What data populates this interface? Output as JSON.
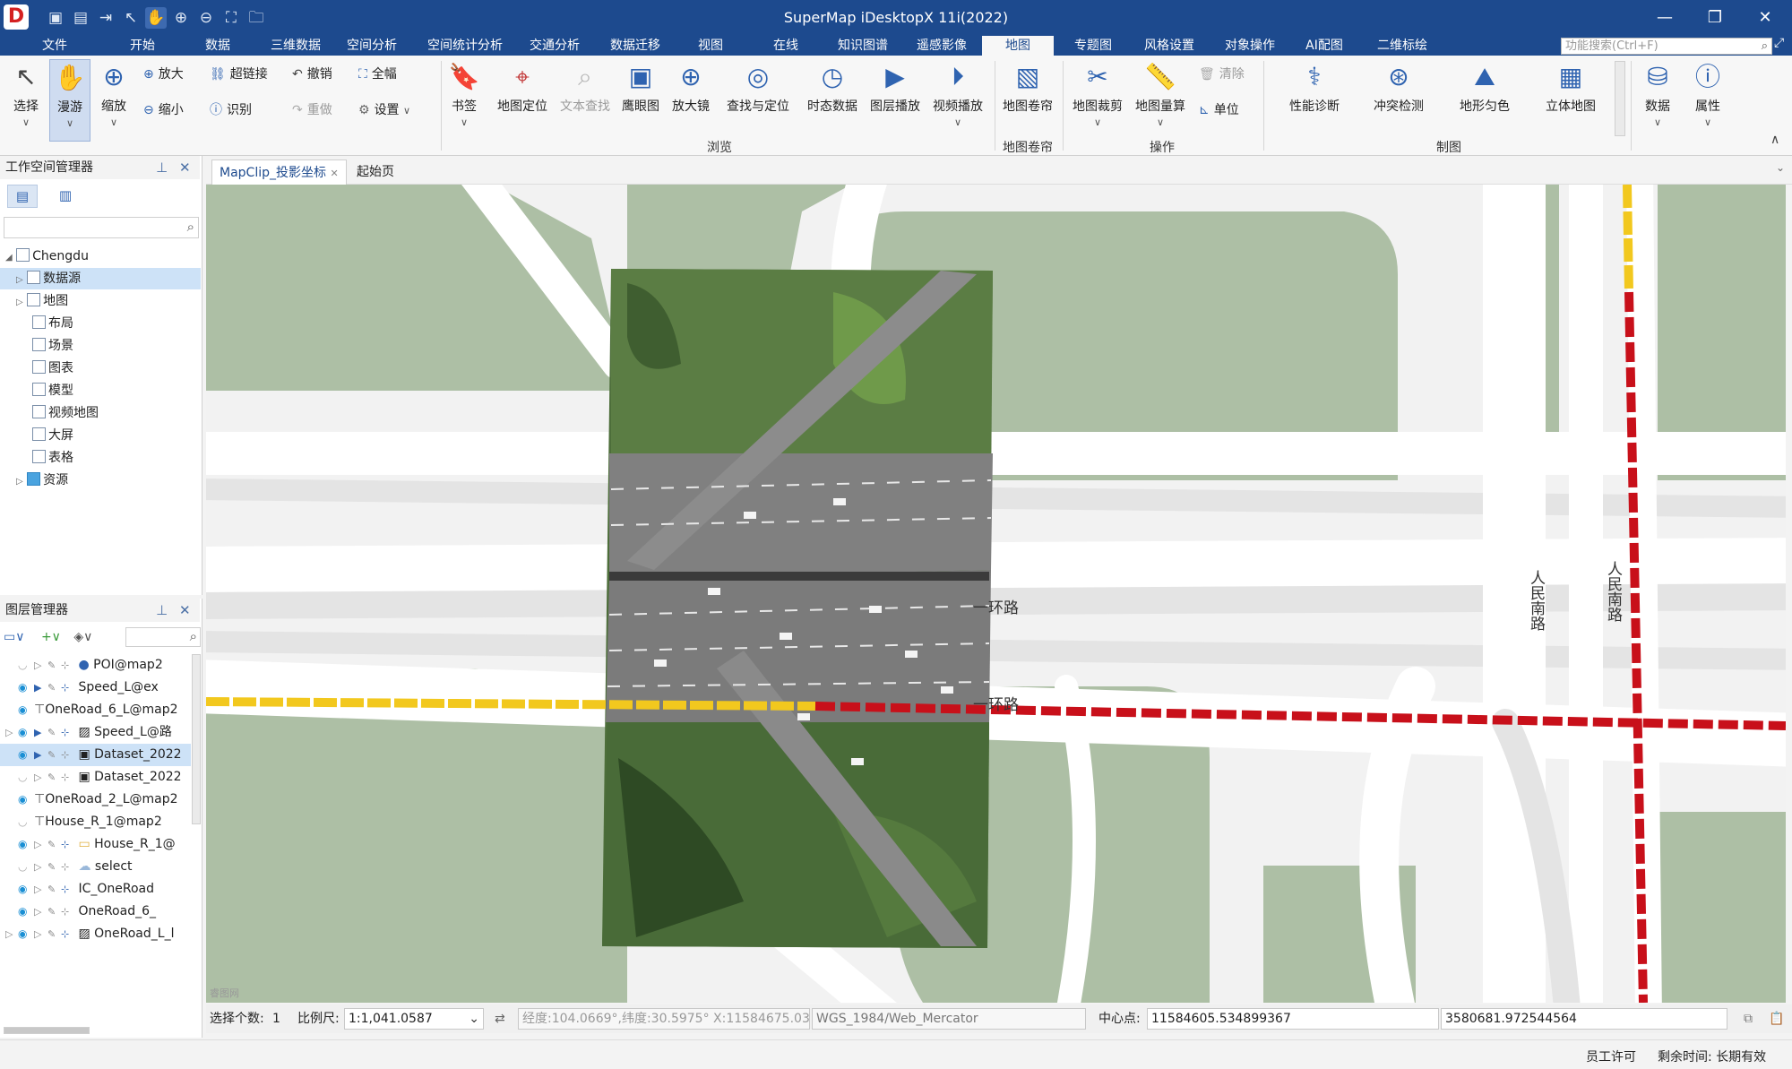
{
  "app": {
    "title": "SuperMap iDesktopX 11i(2022)",
    "logo": "D"
  },
  "menu": {
    "tabs": [
      "文件",
      "开始",
      "数据",
      "三维数据",
      "空间分析",
      "空间统计分析",
      "交通分析",
      "数据迁移",
      "视图",
      "在线",
      "知识图谱",
      "遥感影像",
      "地图",
      "专题图",
      "风格设置",
      "对象操作",
      "AI配图",
      "二维标绘"
    ],
    "active": "地图",
    "search_placeholder": "功能搜索(Ctrl+F)"
  },
  "ribbon": {
    "select": "选择",
    "pan": "漫游",
    "zoom": "缩放",
    "zoom_in": "放大",
    "zoom_out": "缩小",
    "hyperlink": "超链接",
    "identify": "识别",
    "undo": "撤销",
    "redo": "重做",
    "full_extent": "全幅",
    "settings": "设置",
    "bookmark": "书签",
    "map_locate": "地图定位",
    "text_find": "文本查找",
    "eagle_eye": "鹰眼图",
    "magnifier": "放大镜",
    "find_locate": "查找与定位",
    "temporal": "时态数据",
    "layer_play": "图层播放",
    "video_play": "视频播放",
    "group_browse": "浏览",
    "map_shutter": "地图卷帘",
    "group_shutter": "地图卷帘",
    "map_clip": "地图裁剪",
    "map_measure": "地图量算",
    "clear": "清除",
    "unit": "单位",
    "group_ops": "操作",
    "perf_diag": "性能诊断",
    "conflict_check": "冲突检测",
    "terrain_color": "地形匀色",
    "stereo_map": "立体地图",
    "group_carto": "制图",
    "data": "数据",
    "properties": "属性"
  },
  "workspace": {
    "title": "工作空间管理器",
    "root": "Chengdu",
    "items": [
      "数据源",
      "地图",
      "布局",
      "场景",
      "图表",
      "模型",
      "视频地图",
      "大屏",
      "表格",
      "资源"
    ]
  },
  "layers": {
    "title": "图层管理器",
    "items": [
      {
        "name": "POI@map2",
        "visible": false
      },
      {
        "name": "Speed_L@ex",
        "visible": true
      },
      {
        "name": "OneRoad_6_L@map2",
        "visible": true
      },
      {
        "name": "Speed_L@路",
        "visible": true
      },
      {
        "name": "Dataset_2022",
        "visible": true
      },
      {
        "name": "Dataset_2022",
        "visible": false
      },
      {
        "name": "OneRoad_2_L@map2",
        "visible": true
      },
      {
        "name": "House_R_1@map2",
        "visible": false
      },
      {
        "name": "House_R_1@",
        "visible": true
      },
      {
        "name": "select",
        "visible": false
      },
      {
        "name": "IC_OneRoad",
        "visible": true
      },
      {
        "name": "OneRoad_6_",
        "visible": true
      },
      {
        "name": "OneRoad_L_l",
        "visible": true
      }
    ]
  },
  "doc_tabs": [
    "MapClip_投影坐标",
    "起始页"
  ],
  "map": {
    "labels": {
      "ring_road_1": "一环路",
      "ring_road_2": "一环路",
      "renmin_south_1": "人民南路",
      "renmin_south_2": "人民南路"
    },
    "watermark": "睿图网",
    "colors": {
      "background": "#f2f2f2",
      "green": "#adbfa5",
      "road": "#ffffff",
      "red_route": "#c8101a",
      "yellow_route": "#f2c81e"
    }
  },
  "status": {
    "select_count_label": "选择个数:",
    "select_count": "1",
    "scale_label": "比例尺:",
    "scale": "1:1,041.0587",
    "coords": "经度:104.0669°,纬度:30.5975°  X:11584675.03",
    "crs": "WGS_1984/Web_Mercator",
    "center_label": "中心点:",
    "center_x": "11584605.534899367",
    "center_y": "3580681.972544564"
  },
  "footer": {
    "license": "员工许可",
    "remaining": "剩余时间: 长期有效"
  }
}
